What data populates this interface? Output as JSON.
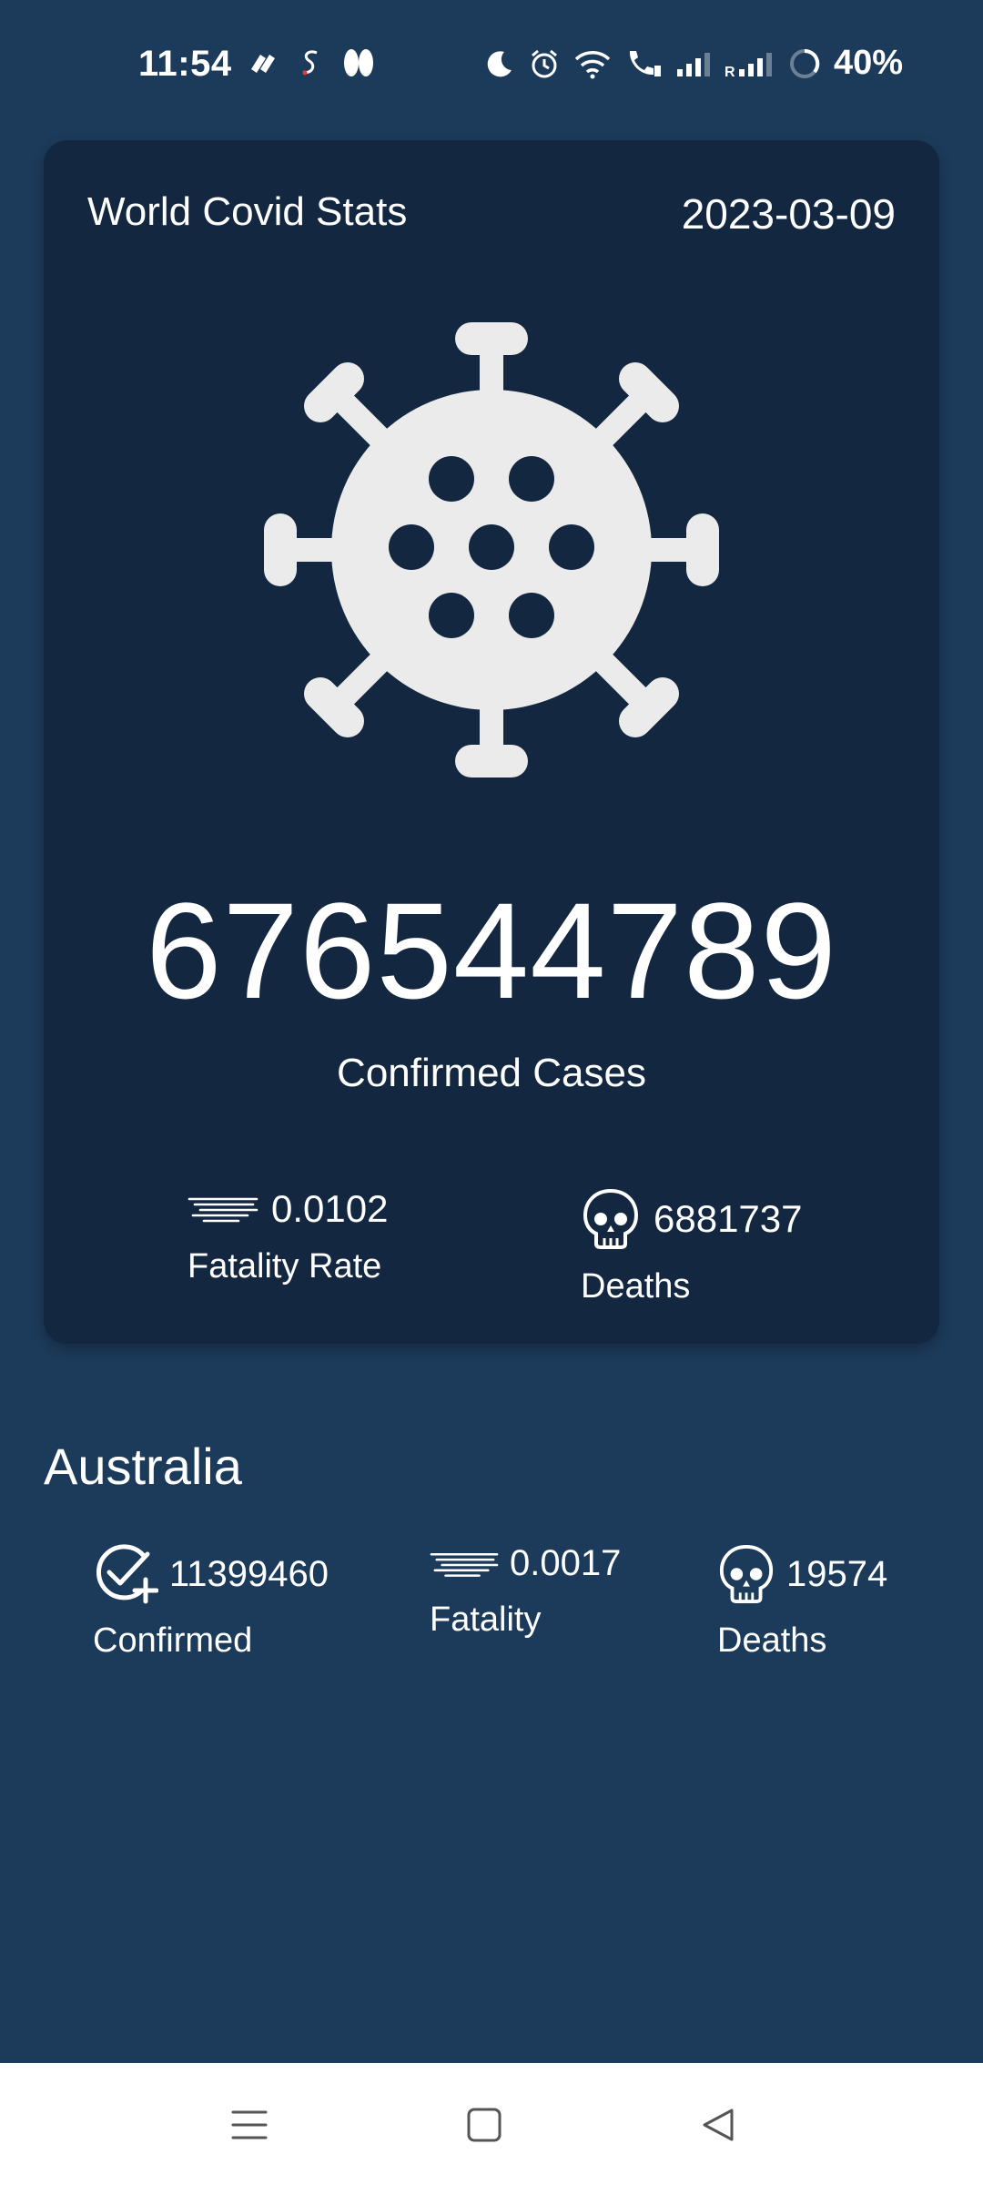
{
  "status_bar": {
    "time": "11:54",
    "battery": "40%"
  },
  "world": {
    "title": "World Covid Stats",
    "date": "2023-03-09",
    "confirmed_value": "676544789",
    "confirmed_label": "Confirmed Cases",
    "fatality_value": "0.0102",
    "fatality_label": "Fatality Rate",
    "deaths_value": "6881737",
    "deaths_label": "Deaths"
  },
  "country": {
    "name": "Australia",
    "confirmed_value": "11399460",
    "confirmed_label": "Confirmed",
    "fatality_value": "0.0017",
    "fatality_label": "Fatality",
    "deaths_value": "19574",
    "deaths_label": "Deaths"
  },
  "nav": {
    "icons": [
      "menu-icon",
      "home-icon",
      "back-icon"
    ]
  },
  "colors": {
    "background": "#1c3a5a",
    "card": "#132740",
    "icon": "#ebebeb",
    "nav_bar": "#ffffff"
  }
}
